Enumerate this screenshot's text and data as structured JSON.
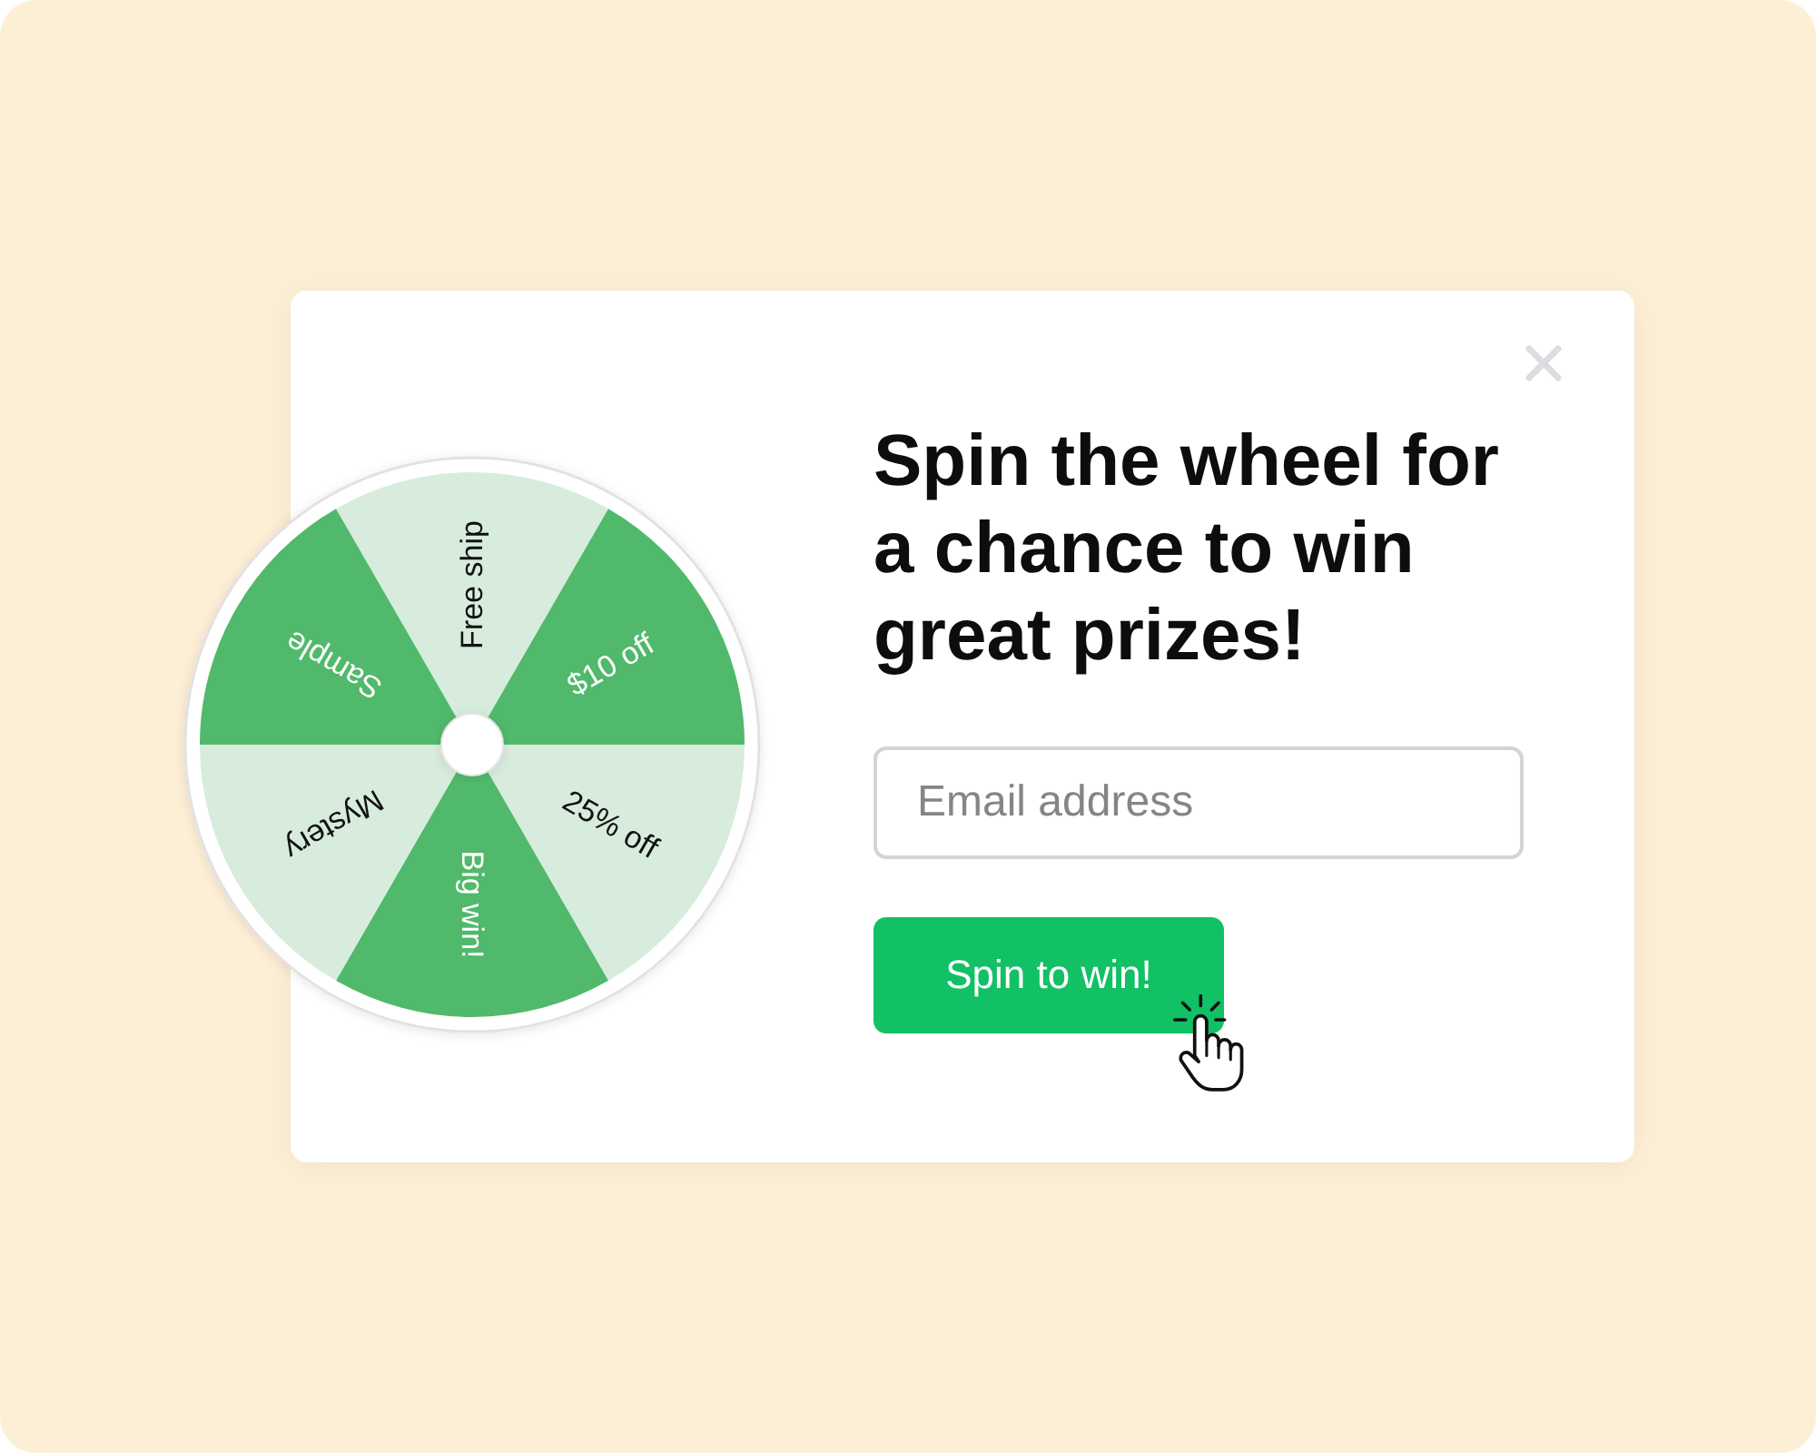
{
  "wheel": {
    "segments": [
      {
        "label": "Free ship",
        "color": "#d7ecdc"
      },
      {
        "label": "$10 off",
        "color": "#50b96b"
      },
      {
        "label": "25% off",
        "color": "#d7ecdc"
      },
      {
        "label": "Big win!",
        "color": "#50b96b"
      },
      {
        "label": "Mystery",
        "color": "#d7ecdc"
      },
      {
        "label": "Sample",
        "color": "#50b96b"
      }
    ]
  },
  "popup": {
    "heading": "Spin the wheel for a chance to win great prizes!",
    "email_field": {
      "placeholder": "Email address"
    },
    "submit_button": {
      "label": "Spin to win!"
    }
  }
}
